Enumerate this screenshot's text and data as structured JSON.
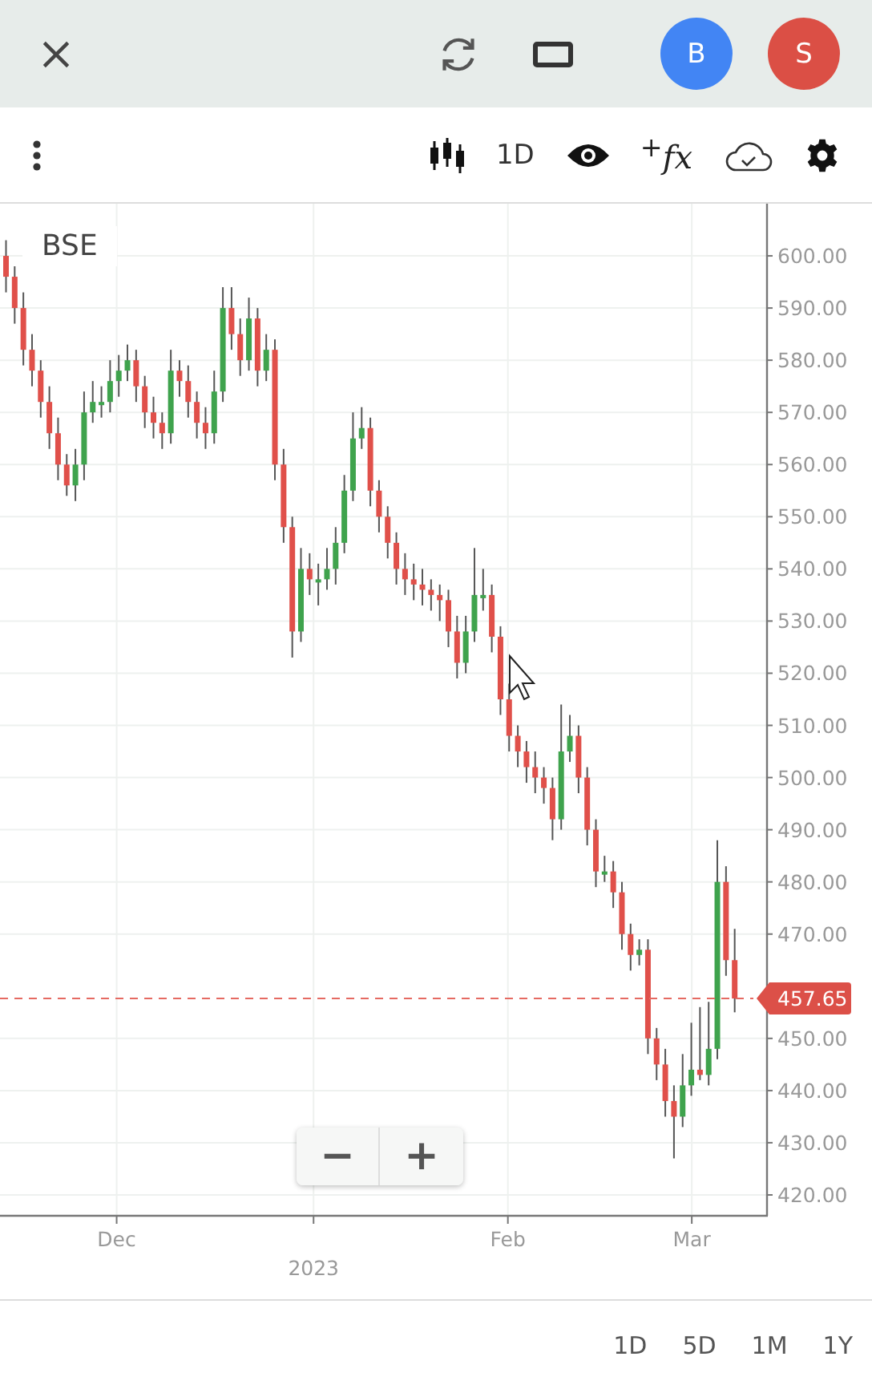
{
  "top_bar": {
    "avatars": [
      {
        "letter": "B",
        "color": "#4285f4"
      },
      {
        "letter": "S",
        "color": "#db4f45"
      }
    ]
  },
  "toolbar": {
    "interval": "1D",
    "indicators_label": "$^{+}$fx"
  },
  "chart": {
    "symbol": "BSE",
    "chart_data": {
      "type": "candlestick",
      "ohlc": [
        [
          600,
          603,
          593,
          596
        ],
        [
          596,
          598,
          587,
          590
        ],
        [
          590,
          593,
          579,
          582
        ],
        [
          582,
          585,
          575,
          578
        ],
        [
          578,
          580,
          569,
          572
        ],
        [
          572,
          575,
          563,
          566
        ],
        [
          566,
          569,
          557,
          560
        ],
        [
          560,
          562,
          554,
          556
        ],
        [
          556,
          563,
          553,
          560
        ],
        [
          560,
          574,
          557,
          570
        ],
        [
          570,
          576,
          568,
          572
        ],
        [
          572,
          575,
          569,
          572
        ],
        [
          572,
          580,
          570,
          576
        ],
        [
          576,
          581,
          573,
          578
        ],
        [
          578,
          583,
          576,
          580
        ],
        [
          580,
          582,
          572,
          575
        ],
        [
          575,
          577,
          567,
          570
        ],
        [
          570,
          573,
          565,
          568
        ],
        [
          568,
          570,
          563,
          566
        ],
        [
          566,
          582,
          564,
          578
        ],
        [
          578,
          580,
          573,
          576
        ],
        [
          576,
          579,
          569,
          572
        ],
        [
          572,
          574,
          565,
          568
        ],
        [
          568,
          571,
          563,
          566
        ],
        [
          566,
          578,
          564,
          574
        ],
        [
          574,
          594,
          572,
          590
        ],
        [
          590,
          594,
          582,
          585
        ],
        [
          585,
          588,
          577,
          580
        ],
        [
          580,
          592,
          578,
          588
        ],
        [
          588,
          590,
          575,
          578
        ],
        [
          578,
          585,
          576,
          582
        ],
        [
          582,
          584,
          557,
          560
        ],
        [
          560,
          563,
          545,
          548
        ],
        [
          548,
          550,
          523,
          528
        ],
        [
          528,
          544,
          526,
          540
        ],
        [
          540,
          543,
          535,
          538
        ],
        [
          538,
          541,
          533,
          538
        ],
        [
          538,
          544,
          536,
          540
        ],
        [
          540,
          548,
          537,
          545
        ],
        [
          545,
          558,
          543,
          555
        ],
        [
          555,
          570,
          553,
          565
        ],
        [
          565,
          571,
          563,
          567
        ],
        [
          567,
          569,
          552,
          555
        ],
        [
          555,
          557,
          547,
          550
        ],
        [
          550,
          552,
          542,
          545
        ],
        [
          545,
          547,
          537,
          540
        ],
        [
          540,
          543,
          535,
          538
        ],
        [
          538,
          541,
          534,
          537
        ],
        [
          537,
          540,
          533,
          536
        ],
        [
          536,
          538,
          532,
          535
        ],
        [
          535,
          537,
          530,
          534
        ],
        [
          534,
          536,
          525,
          528
        ],
        [
          528,
          531,
          519,
          522
        ],
        [
          522,
          531,
          520,
          528
        ],
        [
          528,
          544,
          526,
          535
        ],
        [
          535,
          540,
          532,
          535
        ],
        [
          535,
          537,
          524,
          527
        ],
        [
          527,
          529,
          512,
          515
        ],
        [
          515,
          518,
          505,
          508
        ],
        [
          508,
          510,
          502,
          505
        ],
        [
          505,
          507,
          499,
          502
        ],
        [
          502,
          505,
          497,
          500
        ],
        [
          500,
          502,
          495,
          498
        ],
        [
          498,
          500,
          488,
          492
        ],
        [
          492,
          514,
          490,
          505
        ],
        [
          505,
          512,
          503,
          508
        ],
        [
          508,
          510,
          497,
          500
        ],
        [
          500,
          502,
          487,
          490
        ],
        [
          490,
          492,
          479,
          482
        ],
        [
          482,
          485,
          480,
          482
        ],
        [
          482,
          484,
          475,
          478
        ],
        [
          478,
          480,
          467,
          470
        ],
        [
          470,
          472,
          463,
          466
        ],
        [
          466,
          469,
          464,
          467
        ],
        [
          467,
          469,
          447,
          450
        ],
        [
          450,
          452,
          442,
          445
        ],
        [
          445,
          448,
          435,
          438
        ],
        [
          438,
          441,
          427,
          435
        ],
        [
          435,
          447,
          433,
          441
        ],
        [
          441,
          453,
          439,
          444
        ],
        [
          444,
          456,
          442,
          443
        ],
        [
          443,
          457,
          441,
          448
        ],
        [
          448,
          488,
          446,
          480
        ],
        [
          480,
          483,
          462,
          465
        ],
        [
          465,
          471,
          455,
          457.65
        ]
      ],
      "yticks": [
        {
          "value": 600,
          "label": "600.00"
        },
        {
          "value": 590,
          "label": "590.00"
        },
        {
          "value": 580,
          "label": "580.00"
        },
        {
          "value": 570,
          "label": "570.00"
        },
        {
          "value": 560,
          "label": "560.00"
        },
        {
          "value": 550,
          "label": "550.00"
        },
        {
          "value": 540,
          "label": "540.00"
        },
        {
          "value": 530,
          "label": "530.00"
        },
        {
          "value": 520,
          "label": "520.00"
        },
        {
          "value": 510,
          "label": "510.00"
        },
        {
          "value": 500,
          "label": "500.00"
        },
        {
          "value": 490,
          "label": "490.00"
        },
        {
          "value": 480,
          "label": "480.00"
        },
        {
          "value": 470,
          "label": "470.00"
        },
        {
          "value": 450,
          "label": "450.00"
        },
        {
          "value": 440,
          "label": "440.00"
        },
        {
          "value": 430,
          "label": "430.00"
        },
        {
          "value": 420,
          "label": "420.00"
        }
      ],
      "ylim": [
        416,
        610
      ],
      "grid": true,
      "ref_lines": [
        {
          "axis": "y",
          "value": 457.65,
          "label": "457.65",
          "color": "#e56a62"
        }
      ]
    },
    "time_labels": [
      {
        "label": "Dec",
        "kind": "month"
      },
      {
        "label": "2023",
        "kind": "year"
      },
      {
        "label": "Feb",
        "kind": "month"
      },
      {
        "label": "Mar",
        "kind": "month"
      }
    ],
    "zoom_out": "−",
    "zoom_in": "+"
  },
  "ranges": [
    "1D",
    "5D",
    "1M",
    "1Y"
  ]
}
